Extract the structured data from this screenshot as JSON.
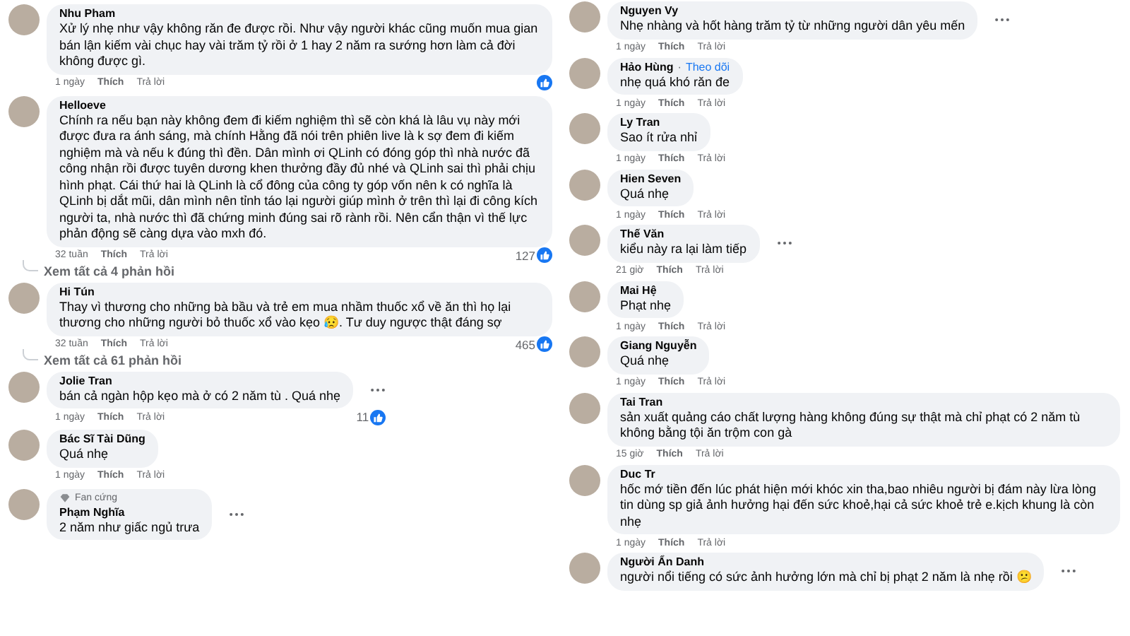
{
  "columns": [
    {
      "comments": [
        {
          "author": "Nhu Pham",
          "text": "Xử lý nhẹ như vậy không răn đe được rồi. Như vậy người khác cũng muốn mua gian bán lận kiếm vài chục hay vài trăm tỷ rồi ở 1 hay 2 năm ra sướng hơn làm cả đời không được gì.",
          "time": "1 ngày",
          "like_action": "Thích",
          "reply_action": "Trả lời",
          "reacted": true,
          "menu": false
        },
        {
          "author": "Helloeve",
          "text": "Chính ra nếu bạn này không đem đi kiếm nghiệm thì sẽ còn khá là lâu vụ này mới được đưa ra ánh sáng, mà chính Hằng đã nói trên phiên live là k sợ đem đi kiếm nghiệm mà và nếu k đúng thì đền. Dân mình ơi QLinh có đóng góp thì nhà nước đã công nhận rồi được tuyên dương khen thưởng đầy đủ nhé và QLinh sai thì phải chịu hình phạt. Cái thứ hai là QLinh là cổ đông của công ty góp vốn nên k có nghĩa là QLinh bị dắt mũi, dân mình nên tỉnh táo lại người giúp mình ở trên thì lại đi công kích người ta, nhà nước thì đã chứng minh đúng sai rõ rành rồi. Nên cẩn thận vì thế lực phản động sẽ càng dựa vào mxh đó.",
          "time": "32 tuần",
          "like_action": "Thích",
          "reply_action": "Trả lời",
          "likes": "127",
          "reacted": true,
          "menu": false,
          "replies_link": "Xem tất cả 4 phản hồi"
        },
        {
          "author": "Hi Tún",
          "text": "Thay vì thương cho những bà bầu và trẻ em mua nhầm thuốc xổ về ăn thì họ lại thương cho những người bỏ thuốc xổ vào kẹo 😥. Tư duy ngược thật đáng sợ",
          "time": "32 tuần",
          "like_action": "Thích",
          "reply_action": "Trả lời",
          "likes": "465",
          "reacted": true,
          "menu": false,
          "replies_link": "Xem tất cả 61 phản hồi"
        },
        {
          "author": "Jolie Tran",
          "text": "bán cả ngàn hộp kẹo mà ở có 2 năm tù . Quá nhẹ",
          "time": "1 ngày",
          "like_action": "Thích",
          "reply_action": "Trả lời",
          "likes": "11",
          "reacted": true,
          "menu": true
        },
        {
          "author": "Bác Sĩ Tài Dũng",
          "text": "Quá nhẹ",
          "time": "1 ngày",
          "like_action": "Thích",
          "reply_action": "Trả lời",
          "reacted": false,
          "menu": false
        },
        {
          "author": "Phạm Nghĩa",
          "badge": "Fan cứng",
          "text": "2 năm như giấc ngủ trưa",
          "reacted": false,
          "menu": true
        }
      ]
    },
    {
      "comments": [
        {
          "author": "Nguyen Vy",
          "text": "Nhẹ nhàng và hốt hàng trăm tỷ từ những người dân yêu mến",
          "time": "1 ngày",
          "like_action": "Thích",
          "reply_action": "Trả lời",
          "reacted": false,
          "menu": true
        },
        {
          "author": "Hảo Hùng",
          "follow_separator": "·",
          "follow": "Theo dõi",
          "text": "nhẹ quá khó răn đe",
          "time": "1 ngày",
          "like_action": "Thích",
          "reply_action": "Trả lời",
          "reacted": false,
          "menu": false
        },
        {
          "author": "Ly Tran",
          "text": "Sao ít rửa nhỉ",
          "time": "1 ngày",
          "like_action": "Thích",
          "reply_action": "Trả lời",
          "reacted": false,
          "menu": false
        },
        {
          "author": "Hien Seven",
          "text": "Quá nhẹ",
          "time": "1 ngày",
          "like_action": "Thích",
          "reply_action": "Trả lời",
          "reacted": false,
          "menu": false
        },
        {
          "author": "Thế Văn",
          "text": "kiểu này ra lại làm tiếp",
          "time": "21 giờ",
          "like_action": "Thích",
          "reply_action": "Trả lời",
          "reacted": false,
          "menu": true
        },
        {
          "author": "Mai Hệ",
          "text": "Phạt nhẹ",
          "time": "1 ngày",
          "like_action": "Thích",
          "reply_action": "Trả lời",
          "reacted": false,
          "menu": false
        },
        {
          "author": "Giang Nguyễn",
          "text": "Quá nhẹ",
          "time": "1 ngày",
          "like_action": "Thích",
          "reply_action": "Trả lời",
          "reacted": false,
          "menu": false
        },
        {
          "author": "Tai Tran",
          "text": "sản xuất quảng cáo chất lượng hàng không đúng sự thật mà chỉ phạt có 2 năm tù không bằng tội ăn trộm con gà",
          "time": "15 giờ",
          "like_action": "Thích",
          "reply_action": "Trả lời",
          "reacted": false,
          "menu": false
        },
        {
          "author": "Duc Tr",
          "text": "hốc mớ tiền đến lúc phát hiện mới khóc xin tha,bao nhiêu người bị đám này lừa lòng tin dùng sp giả ảnh hưởng hại đến sức khoẻ,hại cả sức khoẻ trẻ e.kịch khung là còn nhẹ",
          "time": "1 ngày",
          "like_action": "Thích",
          "reply_action": "Trả lời",
          "reacted": false,
          "menu": false
        },
        {
          "author": "Người Ẩn Danh",
          "text": "người nổi tiếng có sức ảnh hưởng lớn mà chỉ bị phạt 2 năm là nhẹ rồi 😕",
          "reacted": false,
          "menu": true
        }
      ]
    }
  ]
}
